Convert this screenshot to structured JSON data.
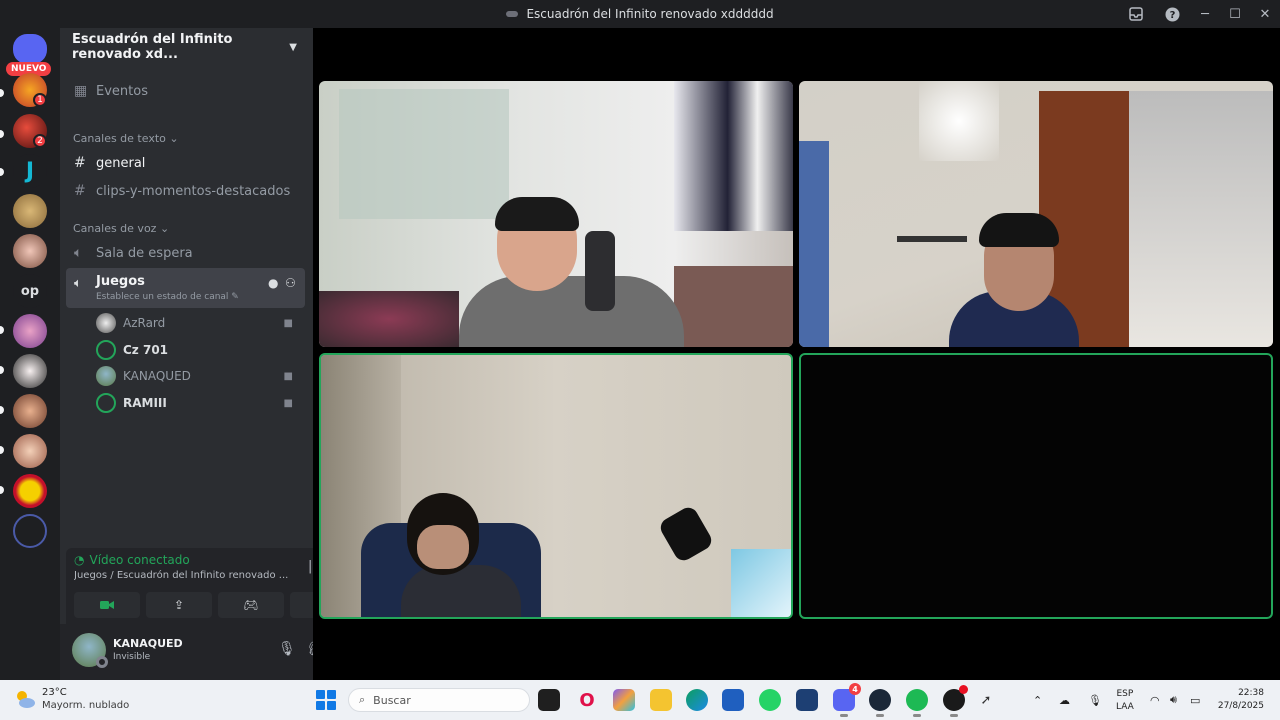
{
  "window": {
    "title": "Escuadrón del Infinito renovado xdddddd"
  },
  "rail": {
    "new_badge": "NUEVO",
    "op_label": "op",
    "badges": [
      "1",
      "2"
    ]
  },
  "server": {
    "name": "Escuadrón del Infinito renovado xd...",
    "events_label": "Eventos"
  },
  "text_channels": {
    "category": "Canales de texto",
    "items": [
      {
        "label": "general"
      },
      {
        "label": "clips-y-momentos-destacados"
      }
    ]
  },
  "voice_channels": {
    "category": "Canales de voz",
    "waiting_room": "Sala de espera",
    "active": {
      "name": "Juegos",
      "status_hint": "Establece un estado de canal"
    },
    "users": [
      {
        "name": "AzRard"
      },
      {
        "name": "Cz 701"
      },
      {
        "name": "KANAQUED"
      },
      {
        "name": "RAMIII"
      }
    ]
  },
  "voice_panel": {
    "status": "Vídeo conectado",
    "path": "Juegos / Escuadrón del Infinito renovado ..."
  },
  "user": {
    "name": "KANAQUED",
    "status": "Invisible"
  },
  "taskbar": {
    "temperature": "23°C",
    "condition": "Mayorm. nublado",
    "search_placeholder": "Buscar",
    "discord_badge": "4",
    "lang_top": "ESP",
    "lang_bottom": "LAA",
    "time": "22:38",
    "date": "27/8/2025"
  },
  "colors": {
    "accent_green": "#23a55a",
    "danger_red": "#f23f43",
    "sidebar_bg": "#2b2d31",
    "rail_bg": "#1e1f22"
  }
}
